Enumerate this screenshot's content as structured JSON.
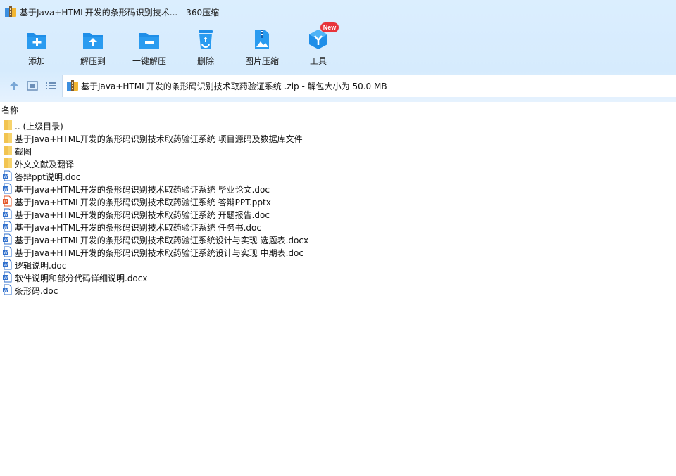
{
  "window": {
    "title": "基于Java+HTML开发的条形码识别技术... - 360压缩"
  },
  "toolbar": {
    "items": [
      {
        "label": "添加",
        "icon": "add-folder-icon"
      },
      {
        "label": "解压到",
        "icon": "extract-to-icon"
      },
      {
        "label": "一键解压",
        "icon": "one-click-extract-icon"
      },
      {
        "label": "删除",
        "icon": "recycle-bin-icon"
      },
      {
        "label": "图片压缩",
        "icon": "image-compress-icon"
      },
      {
        "label": "工具",
        "icon": "tools-icon"
      }
    ],
    "new_badge": "New"
  },
  "address": {
    "path": "基于Java+HTML开发的条形码识别技术取药验证系统 .zip - 解包大小为 50.0 MB"
  },
  "list": {
    "column_name": "名称",
    "rows": [
      {
        "name": ".. (上级目录)",
        "type": "folder"
      },
      {
        "name": "基于Java+HTML开发的条形码识别技术取药验证系统 项目源码及数据库文件",
        "type": "folder"
      },
      {
        "name": "截图",
        "type": "folder"
      },
      {
        "name": "外文文献及翻译",
        "type": "folder"
      },
      {
        "name": "答辩ppt说明.doc",
        "type": "doc"
      },
      {
        "name": "基于Java+HTML开发的条形码识别技术取药验证系统 毕业论文.doc",
        "type": "doc"
      },
      {
        "name": "基于Java+HTML开发的条形码识别技术取药验证系统 答辩PPT.pptx",
        "type": "pptx"
      },
      {
        "name": "基于Java+HTML开发的条形码识别技术取药验证系统 开题报告.doc",
        "type": "doc"
      },
      {
        "name": "基于Java+HTML开发的条形码识别技术取药验证系统 任务书.doc",
        "type": "doc"
      },
      {
        "name": "基于Java+HTML开发的条形码识别技术取药验证系统设计与实现 选题表.docx",
        "type": "docx"
      },
      {
        "name": "基于Java+HTML开发的条形码识别技术取药验证系统设计与实现 中期表.doc",
        "type": "doc"
      },
      {
        "name": "逻辑说明.doc",
        "type": "doc"
      },
      {
        "name": "软件说明和部分代码详细说明.docx",
        "type": "docx"
      },
      {
        "name": "条形码.doc",
        "type": "doc"
      }
    ]
  },
  "colors": {
    "toolbar_bg": "#d6ebfd",
    "icon_blue": "#1f8ee8",
    "folder_yellow": "#f7d36b",
    "ppt_orange": "#e4582b",
    "doc_blue": "#2f6fcc"
  }
}
